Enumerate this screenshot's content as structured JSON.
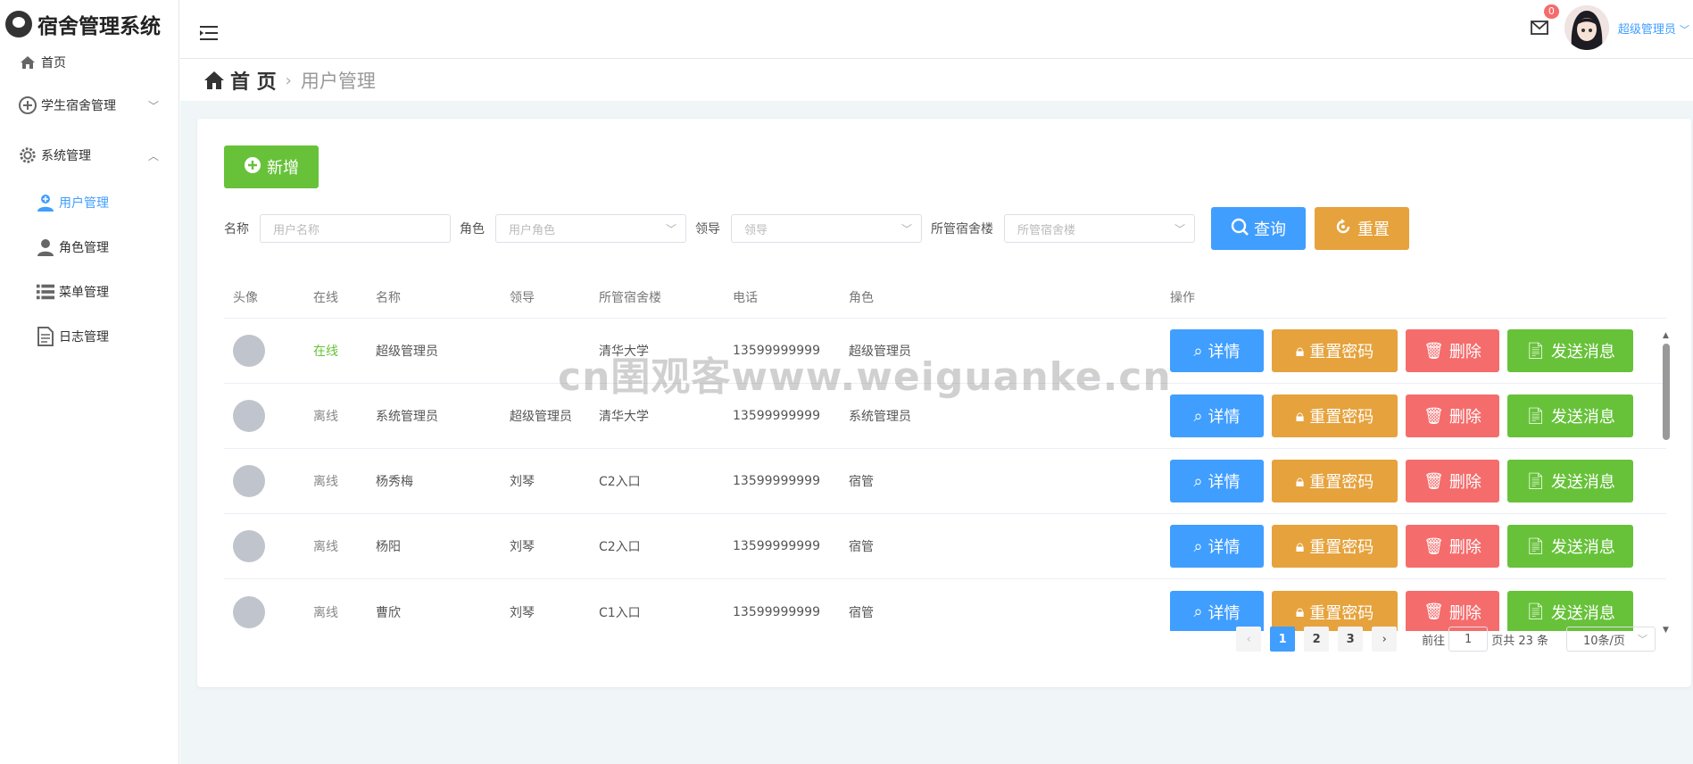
{
  "app_title": "宿舍管理系统",
  "sidebar": {
    "items": [
      {
        "label": "首页",
        "icon": "home-icon"
      },
      {
        "label": "学生宿舍管理",
        "icon": "plus-circle-icon"
      },
      {
        "label": "系统管理",
        "icon": "gear-icon"
      }
    ],
    "sub_items": [
      {
        "label": "用户管理",
        "icon": "user-add-icon",
        "active": true
      },
      {
        "label": "角色管理",
        "icon": "user-icon"
      },
      {
        "label": "菜单管理",
        "icon": "list-icon"
      },
      {
        "label": "日志管理",
        "icon": "document-icon"
      }
    ]
  },
  "header": {
    "message_count": "0",
    "user_name": "超级管理员"
  },
  "breadcrumb": {
    "home": "首 页",
    "current": "用户管理"
  },
  "toolbar": {
    "add_label": "新增",
    "search_label": "查询",
    "reset_label": "重置"
  },
  "filters": {
    "name_label": "名称",
    "name_placeholder": "用户名称",
    "role_label": "角色",
    "role_placeholder": "用户角色",
    "leader_label": "领导",
    "leader_placeholder": "领导",
    "building_label": "所管宿舍楼",
    "building_placeholder": "所管宿舍楼"
  },
  "table": {
    "columns": [
      "头像",
      "在线",
      "名称",
      "领导",
      "所管宿舍楼",
      "电话",
      "角色",
      "操作"
    ],
    "rows": [
      {
        "online": "在线",
        "name": "超级管理员",
        "leader": "",
        "building": "清华大学",
        "phone": "13599999999",
        "role": "超级管理员"
      },
      {
        "online": "离线",
        "name": "系统管理员",
        "leader": "超级管理员",
        "building": "清华大学",
        "phone": "13599999999",
        "role": "系统管理员"
      },
      {
        "online": "离线",
        "name": "杨秀梅",
        "leader": "刘琴",
        "building": "C2入口",
        "phone": "13599999999",
        "role": "宿管"
      },
      {
        "online": "离线",
        "name": "杨阳",
        "leader": "刘琴",
        "building": "C2入口",
        "phone": "13599999999",
        "role": "宿管"
      },
      {
        "online": "离线",
        "name": "曹欣",
        "leader": "刘琴",
        "building": "C1入口",
        "phone": "13599999999",
        "role": "宿管"
      }
    ],
    "actions": {
      "detail": "详情",
      "reset_pwd": "重置密码",
      "delete": "删除",
      "send_msg": "发送消息"
    }
  },
  "pagination": {
    "pages": [
      "1",
      "2",
      "3"
    ],
    "current": "1",
    "goto_label": "前往",
    "goto_value": "1",
    "total_label": "页共 23 条",
    "page_size": "10条/页"
  },
  "watermark": "cn圉观客www.weiguanke.cn",
  "colors": {
    "primary": "#409eff",
    "success": "#67c23a",
    "warning": "#e6a23c",
    "danger": "#f56c6c"
  }
}
